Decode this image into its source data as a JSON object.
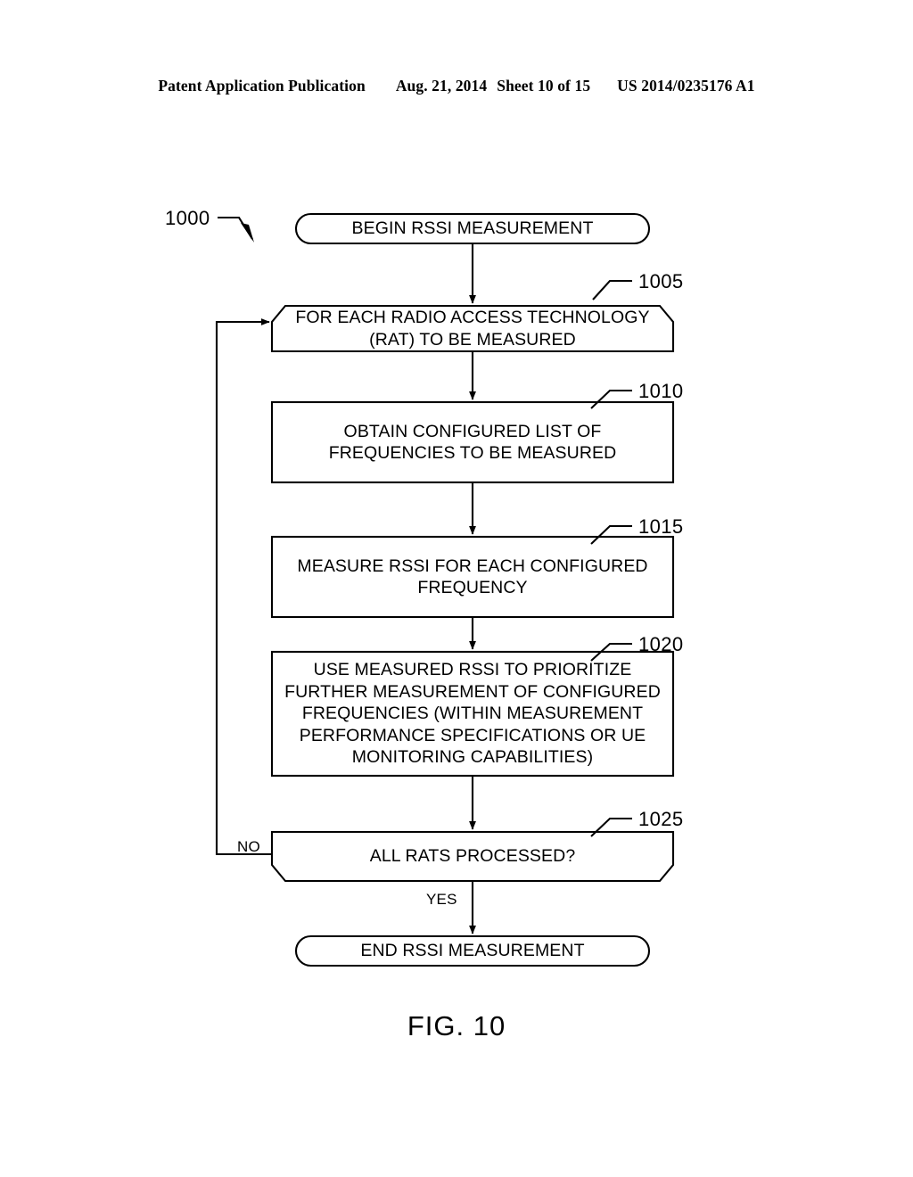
{
  "header": {
    "publication": "Patent Application Publication",
    "date": "Aug. 21, 2014",
    "sheet": "Sheet 10 of 15",
    "patent_number": "US 2014/0235176 A1"
  },
  "figure": {
    "caption": "FIG. 10",
    "diagram_ref": "1000"
  },
  "flowchart": {
    "nodes": [
      {
        "id": "begin",
        "ref": "",
        "shape": "stadium",
        "text": "BEGIN RSSI MEASUREMENT"
      },
      {
        "id": "for-each-rat",
        "ref": "1005",
        "shape": "loop-start",
        "text": "FOR EACH RADIO ACCESS TECHNOLOGY\n(RAT) TO BE MEASURED"
      },
      {
        "id": "obtain-list",
        "ref": "1010",
        "shape": "rect",
        "text": "OBTAIN CONFIGURED LIST OF\nFREQUENCIES TO BE MEASURED"
      },
      {
        "id": "measure-rssi",
        "ref": "1015",
        "shape": "rect",
        "text": "MEASURE RSSI FOR EACH CONFIGURED\nFREQUENCY"
      },
      {
        "id": "prioritize",
        "ref": "1020",
        "shape": "rect",
        "text": "USE MEASURED RSSI TO PRIORITIZE\nFURTHER MEASUREMENT OF CONFIGURED\nFREQUENCIES (WITHIN MEASUREMENT\nPERFORMANCE SPECIFICATIONS OR UE\nMONITORING CAPABILITIES)"
      },
      {
        "id": "all-rats",
        "ref": "1025",
        "shape": "loop-end",
        "text": "ALL RATS PROCESSED?"
      },
      {
        "id": "end",
        "ref": "",
        "shape": "stadium",
        "text": "END RSSI MEASUREMENT"
      }
    ],
    "edge_labels": {
      "no": "NO",
      "yes": "YES"
    }
  },
  "colors": {
    "line": "#000000",
    "text": "#000000",
    "background": "#ffffff"
  }
}
